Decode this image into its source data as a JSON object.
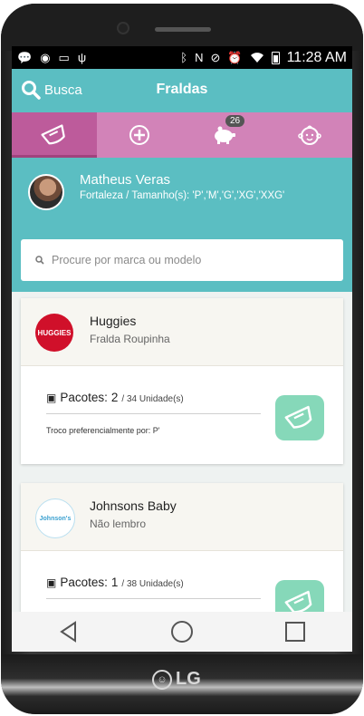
{
  "status_bar": {
    "time": "11:28 AM",
    "left_icons": [
      "chat-icon",
      "whatsapp-icon",
      "voicemail-icon",
      "usb-icon"
    ],
    "right_icons": [
      "bluetooth-icon",
      "nfc-icon",
      "mute-icon",
      "alarm-icon",
      "wifi-icon",
      "battery-icon"
    ]
  },
  "app_bar": {
    "search_label": "Busca",
    "title": "Fraldas"
  },
  "tabs": [
    {
      "name": "diaper",
      "active": true
    },
    {
      "name": "add",
      "active": false
    },
    {
      "name": "piggy-bank",
      "active": false,
      "badge": "26"
    },
    {
      "name": "baby",
      "active": false
    }
  ],
  "profile": {
    "name": "Matheus Veras",
    "subtitle": "Fortaleza / Tamanho(s): 'P','M','G','XG','XXG'"
  },
  "search": {
    "placeholder": "Procure por marca ou modelo"
  },
  "cards": [
    {
      "brand": "Huggies",
      "model": "Fralda Roupinha",
      "packs_label": "Pacotes:",
      "packs_count": "2",
      "units": "/ 34 Unidade(s)",
      "preference": "Troco preferencialmente por: P'"
    },
    {
      "brand": "Johnsons Baby",
      "model": "Não lembro",
      "packs_label": "Pacotes:",
      "packs_count": "1",
      "units": "/ 38 Unidade(s)",
      "preference": ""
    }
  ],
  "colors": {
    "teal": "#5bbec2",
    "tab_pink": "#d283b8",
    "tab_active": "#bd5b9b",
    "mint": "#86d8b9",
    "huggies_red": "#d0102a"
  },
  "device_brand": "LG"
}
